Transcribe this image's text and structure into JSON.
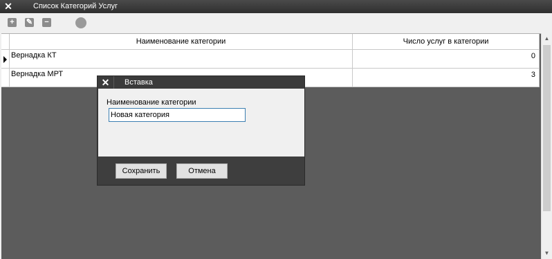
{
  "window": {
    "close_glyph": "✕",
    "title": "Список Категорий Услуг"
  },
  "toolbar": {
    "add_glyph": "+",
    "edit_glyph": "✎",
    "delete_glyph": "−"
  },
  "table": {
    "columns": [
      "Наименование категории",
      "Число услуг в категории"
    ],
    "rows": [
      {
        "name": "Вернадка КТ",
        "count": "0",
        "selected": true
      },
      {
        "name": "Вернадка МРТ",
        "count": "3",
        "selected": false
      }
    ]
  },
  "dialog": {
    "close_glyph": "✕",
    "title": "Вставка",
    "field_label": "Наименование категории",
    "field_value": "Новая категория",
    "save_label": "Сохранить",
    "cancel_label": "Отмена"
  },
  "scrollbar": {
    "up_glyph": "▲",
    "down_glyph": "▼"
  }
}
